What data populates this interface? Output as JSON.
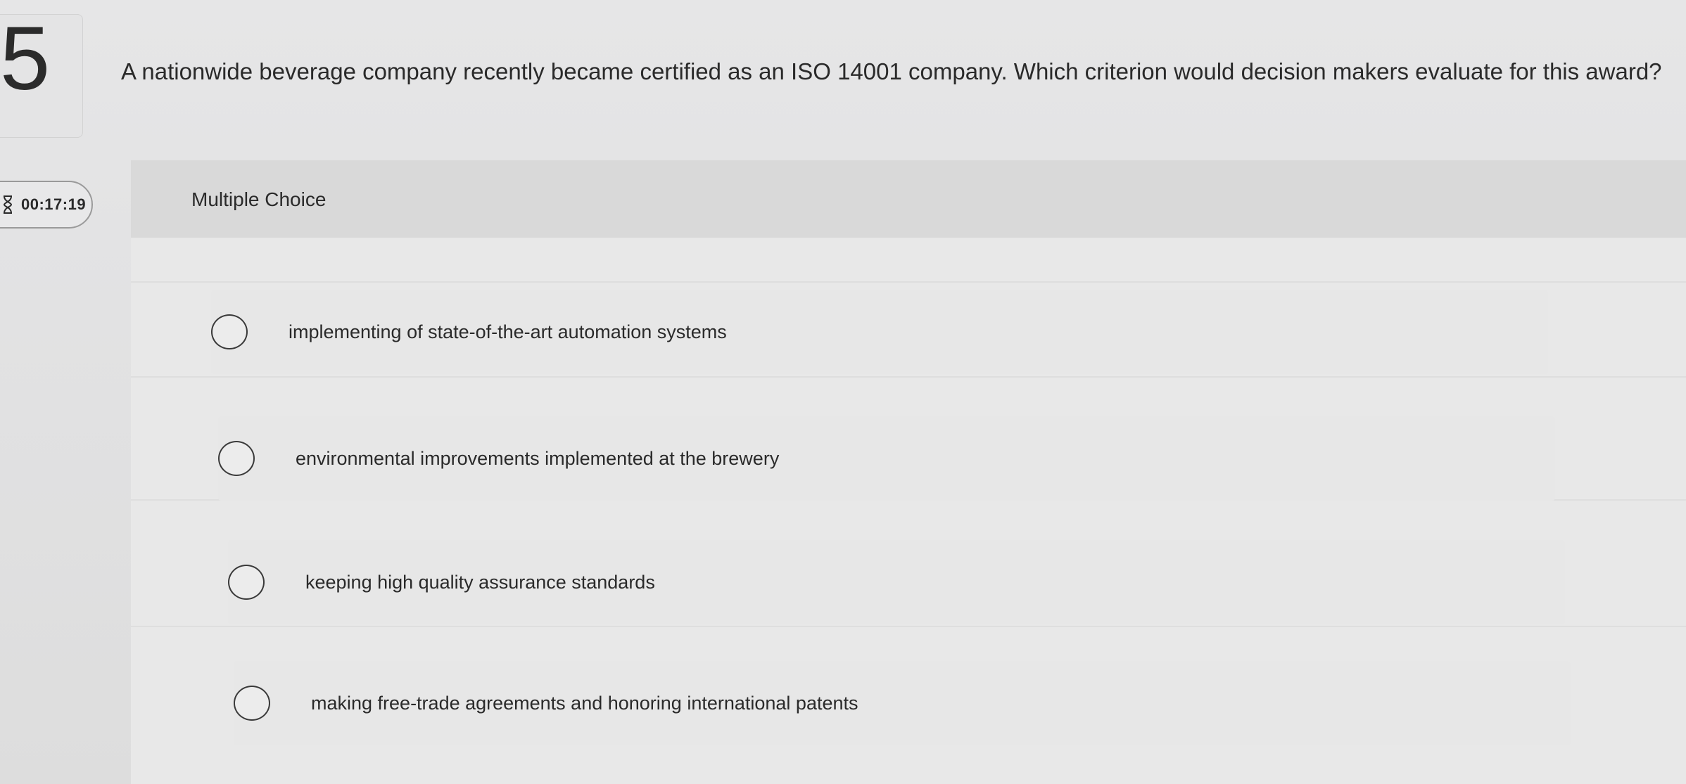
{
  "question": {
    "number": "5",
    "text": "A nationwide beverage company recently became certified as an ISO 14001 company. Which criterion would decision makers evaluate for this award?"
  },
  "timer": {
    "icon": "hourglass-icon",
    "value": "00:17:19"
  },
  "panel": {
    "header_label": "Multiple Choice"
  },
  "options": [
    {
      "label": "implementing of state-of-the-art automation systems",
      "selected": false
    },
    {
      "label": "environmental improvements implemented at the brewery",
      "selected": false
    },
    {
      "label": "keeping high quality assurance standards",
      "selected": false
    },
    {
      "label": "making free-trade agreements and honoring international patents",
      "selected": false
    }
  ],
  "colors": {
    "background": "#e2e2e3",
    "panel_header": "#d9d9d9",
    "text": "#2a2a2a",
    "radio_border": "#3a3a3a"
  }
}
